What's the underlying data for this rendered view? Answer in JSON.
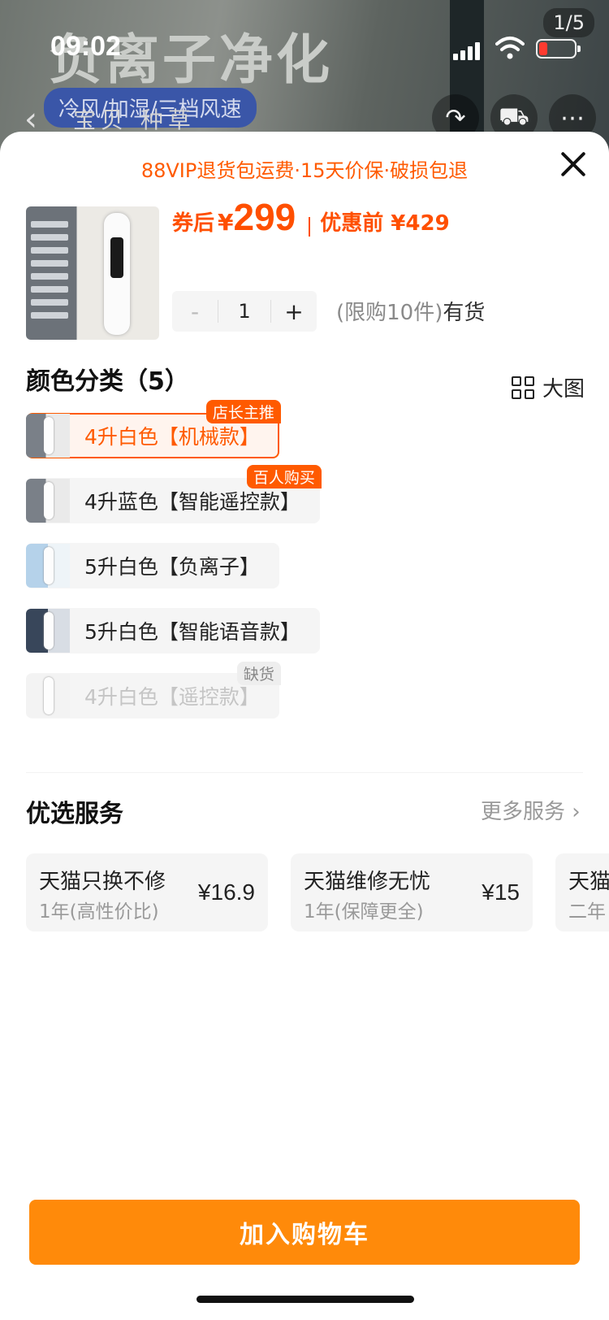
{
  "status_bar": {
    "time": "09:02"
  },
  "background": {
    "headline": "负离子净化",
    "feature_tag": "冷风/加湿/三档风速",
    "nav_tabs": "宝贝  种草",
    "page_indicator": "1/5"
  },
  "sheet": {
    "promo": "88VIP退货包运费·15天价保·破损包退",
    "price": {
      "label": "券后",
      "currency": "¥",
      "value": "299",
      "original": "优惠前 ¥429"
    },
    "stepper": {
      "minus": "-",
      "qty": "1",
      "plus": "+"
    },
    "stock": {
      "limit": "(限购10件)",
      "status": "有货"
    },
    "color_section": {
      "title": "颜色分类（5）",
      "big_pic": "大图"
    },
    "options": [
      {
        "label": "4升白色【机械款】",
        "badge": "店长主推",
        "selected": true
      },
      {
        "label": "4升蓝色【智能遥控款】",
        "badge": "百人购买"
      },
      {
        "label": "5升白色【负离子】"
      },
      {
        "label": "5升白色【智能语音款】"
      },
      {
        "label": "4升白色【遥控款】",
        "badge": "缺货",
        "disabled": true
      }
    ],
    "services": {
      "title": "优选服务",
      "more": "更多服务",
      "cards": [
        {
          "name": "天猫只换不修",
          "desc": "1年(高性价比)",
          "price": "¥16.9"
        },
        {
          "name": "天猫维修无忧",
          "desc": "1年(保障更全)",
          "price": "¥15"
        },
        {
          "name": "天猫",
          "desc": "二年"
        }
      ]
    },
    "cart_button": "加入购物车"
  },
  "colors": {
    "accent": "#ff5a00",
    "button": "#ff8a0a",
    "battery_low": "#ff3b30"
  }
}
